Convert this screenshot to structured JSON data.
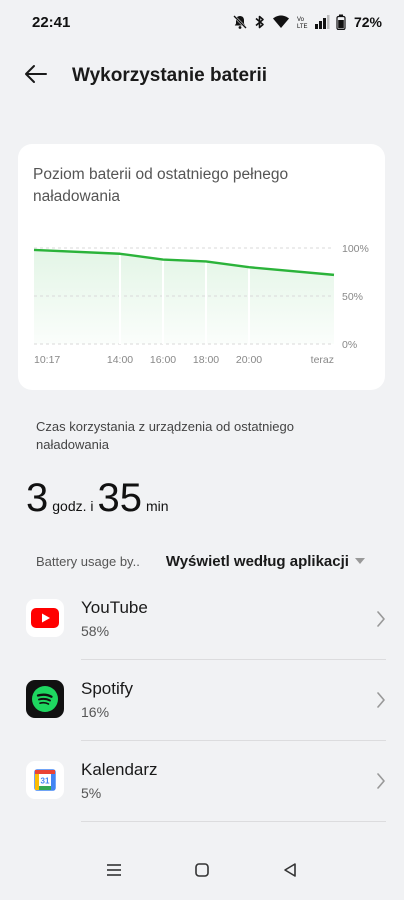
{
  "status_bar": {
    "time": "22:41",
    "battery_percent": "72%"
  },
  "header": {
    "title": "Wykorzystanie baterii"
  },
  "chart_card": {
    "title": "Poziom baterii od ostatniego pełnego naładowania",
    "chart_data": {
      "type": "area",
      "x_tick_labels": [
        "10:17",
        "14:00",
        "16:00",
        "18:00",
        "20:00",
        "teraz"
      ],
      "y_tick_labels": [
        "100%",
        "50%",
        "0%"
      ],
      "ylim": [
        0,
        100
      ],
      "series": [
        {
          "values": [
            {
              "x": "10:17",
              "y": 98
            },
            {
              "x": "14:00",
              "y": 94
            },
            {
              "x": "16:00",
              "y": 88
            },
            {
              "x": "18:00",
              "y": 86
            },
            {
              "x": "20:00",
              "y": 80
            },
            {
              "x": "teraz",
              "y": 72
            }
          ]
        }
      ],
      "grid": true,
      "colors": {
        "line": "#2bb33a",
        "fill": "#e3f5e6",
        "grid": "#d9d9d9"
      }
    }
  },
  "usage": {
    "caption": "Czas korzystania z urządzenia od ostatniego naładowania",
    "hours": "3",
    "hours_unit": "godz. i",
    "minutes": "35",
    "minutes_unit": "min"
  },
  "filter": {
    "label": "Battery usage by..",
    "value": "Wyświetl według aplikacji"
  },
  "apps": [
    {
      "name": "YouTube",
      "percent": "58%",
      "icon": "youtube-icon"
    },
    {
      "name": "Spotify",
      "percent": "16%",
      "icon": "spotify-icon"
    },
    {
      "name": "Kalendarz",
      "percent": "5%",
      "icon": "calendar-icon",
      "icon_text": "31"
    }
  ]
}
